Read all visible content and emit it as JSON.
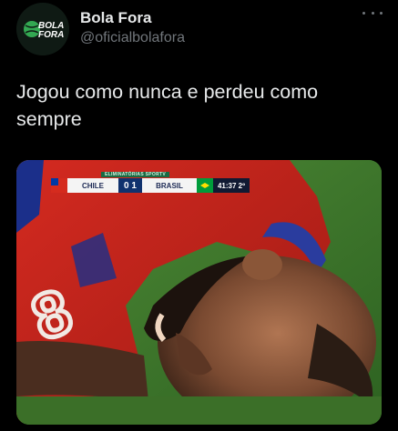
{
  "profile": {
    "name": "Bola Fora",
    "handle": "@oficialbolafora",
    "avatar_text_line1": "BOLA",
    "avatar_text_line2": "FORA"
  },
  "tweet": {
    "text": "Jogou como nunca e perdeu como sempre"
  },
  "media": {
    "scoreboard": {
      "banner": "ELIMINATÓRIAS SPORTV",
      "home_team": "CHILE",
      "score": "0 1",
      "away_team": "BRASIL",
      "clock": "41:37 2º"
    },
    "jersey_number": "8"
  },
  "colors": {
    "background": "#000000",
    "text": "#e7e9ea",
    "secondary_text": "#71767b",
    "pitch": "#2c6a24",
    "jersey": "#c8241c"
  },
  "icons": {
    "more": "more-dots-icon"
  }
}
